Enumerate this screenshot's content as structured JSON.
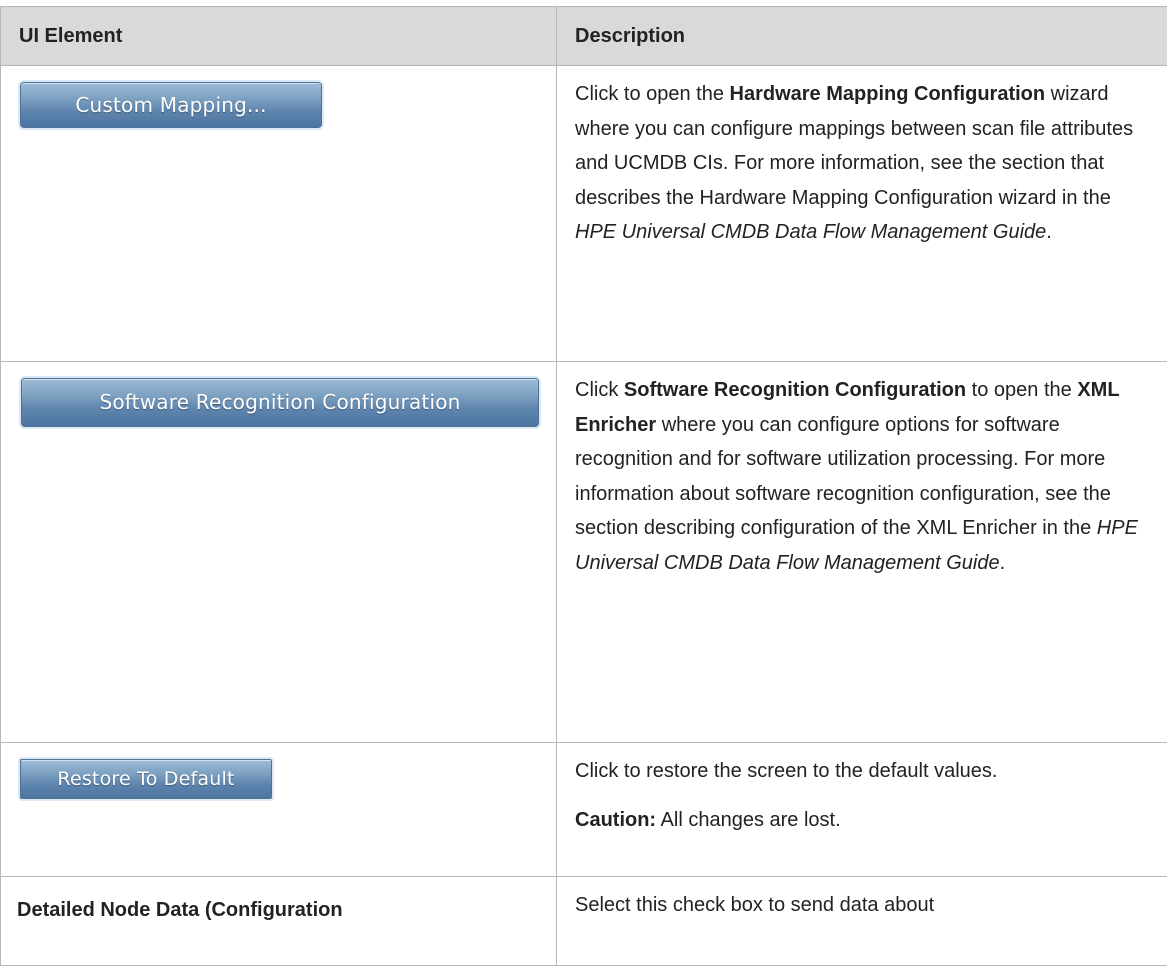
{
  "table": {
    "headers": [
      "UI Element",
      "Description"
    ],
    "rows": [
      {
        "button": "Custom Mapping...",
        "desc": {
          "p1": "Click to open the ",
          "b1": "Hardware Mapping Configuration",
          "p2": " wizard where you can configure mappings between scan file attributes and UCMDB CIs. For more information, see the section that describes the Hardware Mapping Configuration wizard in the ",
          "i1": "HPE Universal CMDB Data Flow Management Guide",
          "p3": "."
        }
      },
      {
        "button": "Software Recognition Configuration",
        "desc": {
          "p1": "Click ",
          "b1": "Software Recognition Configuration",
          "p2": " to open the ",
          "b2": "XML Enricher",
          "p3": " where you can configure options for software recognition and for software utilization processing. For more information about software recognition configuration, see the section describing configuration of the XML Enricher in the ",
          "i1": "HPE Universal CMDB Data Flow Management Guide",
          "p4": "."
        }
      },
      {
        "button": "Restore To Default",
        "desc": {
          "p1": "Click to restore the screen to the default values.",
          "caution_label": "Caution:",
          "caution_text": " All changes are lost."
        }
      },
      {
        "label": "Detailed Node Data (Configuration",
        "desc": {
          "p1": "Select this check box to send data about"
        }
      }
    ]
  }
}
